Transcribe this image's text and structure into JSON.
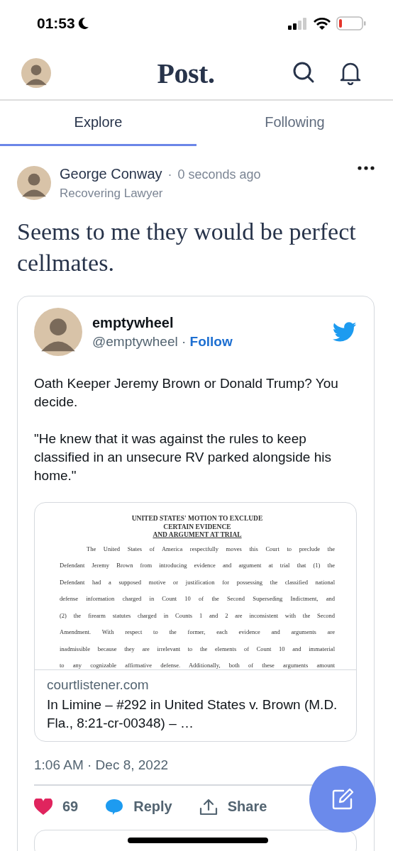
{
  "status_bar": {
    "time": "01:53"
  },
  "header": {
    "logo": "Post."
  },
  "tabs": [
    {
      "label": "Explore",
      "selected": true
    },
    {
      "label": "Following",
      "selected": false
    }
  ],
  "post": {
    "author": "George Conway",
    "separator": "·",
    "time": "0 seconds ago",
    "subtitle": "Recovering Lawyer",
    "text": "Seems to me they would be perfect cellmates.",
    "embed": {
      "name": "emptywheel",
      "handle": "@emptywheel",
      "separator": "·",
      "follow": "Follow",
      "paragraphs": [
        "Oath Keeper Jeremy Brown or Donald Trump? You decide.",
        "\"He knew that it was against the rules to keep classified in an unsecure RV parked alongside his home.\""
      ],
      "link": {
        "document": {
          "heading": [
            "UNITED STATES' MOTION TO EXCLUDE",
            "CERTAIN EVIDENCE",
            "AND ARGUMENT AT TRIAL"
          ],
          "lines": [
            "The United States of America respectfully moves this Court to preclude the",
            "Defendant Jeremy Brown from introducing evidence and argument at trial that (1) the",
            "Defendant had a supposed motive or justification for possessing the classified national",
            "defense information charged in Count 10 of the Second Superseding Indictment, and",
            "(2) the firearm statutes charged in Counts 1 and 2 are inconsistent with the Second",
            "Amendment. With respect to the former, each evidence and arguments are",
            "inadmissible because they are irrelevant to the elements of Count 10 and immaterial",
            "to any cognizable affirmative defense. Additionally, both of these arguments amount"
          ]
        },
        "domain": "courtlistener.com",
        "title": "In Limine – #292 in United States v. Brown (M.D. Fla., 8:21-cr-00348) – …"
      },
      "timestamp": "1:06 AM · Dec 8, 2022",
      "likes": "69",
      "reply": "Reply",
      "share": "Share"
    }
  }
}
